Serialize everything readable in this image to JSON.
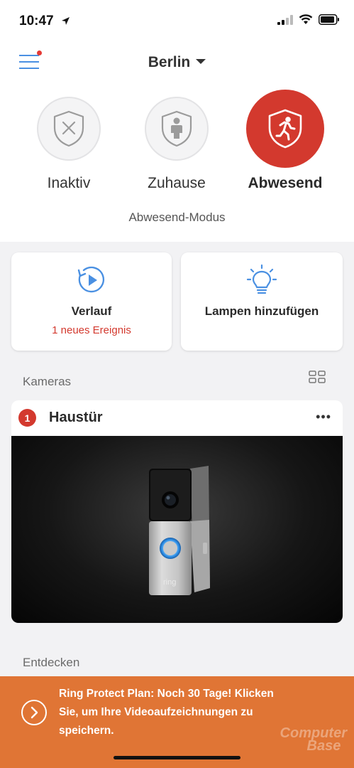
{
  "status": {
    "time": "10:47"
  },
  "header": {
    "location": "Berlin"
  },
  "modes": [
    {
      "label": "Inaktiv"
    },
    {
      "label": "Zuhause"
    },
    {
      "label": "Abwesend"
    }
  ],
  "mode_subtitle": "Abwesend-Modus",
  "cards": {
    "history_title": "Verlauf",
    "history_sub": "1 neues Ereignis",
    "lamps_title": "Lampen hinzufügen"
  },
  "cameras": {
    "section_label": "Kameras",
    "badge": "1",
    "name": "Haustür",
    "more": "•••",
    "device_brand": "ring"
  },
  "discover_label": "Entdecken",
  "banner": {
    "text": "Ring Protect Plan: Noch 30 Tage! Klicken Sie, um Ihre Videoaufzeichnungen zu speichern."
  },
  "watermark": {
    "line1": "Computer",
    "line2": "Base"
  },
  "colors": {
    "accent_red": "#d3392e",
    "accent_blue": "#4a90e2",
    "banner_orange": "#e07535"
  }
}
